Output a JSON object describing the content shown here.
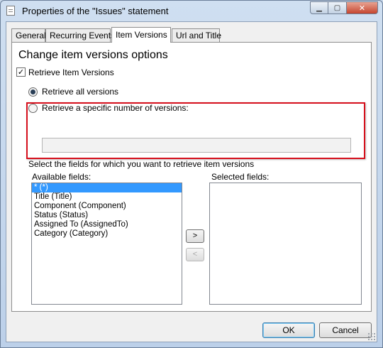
{
  "window": {
    "title": "Properties of the \"Issues\" statement"
  },
  "tabs": [
    {
      "label": "General"
    },
    {
      "label": "Recurring Events"
    },
    {
      "label": "Item Versions"
    },
    {
      "label": "Url and Title"
    }
  ],
  "panel": {
    "heading": "Change item versions options",
    "retrieve_checkbox": {
      "label": "Retrieve Item Versions",
      "checked": true
    },
    "radio_all": {
      "label": "Retrieve all versions",
      "selected": true
    },
    "radio_specific": {
      "label": "Retrieve a specific number of versions:",
      "selected": false
    },
    "number_of_versions": {
      "value": ""
    },
    "fields_prompt": "Select the fields for which you want to retrieve item versions",
    "available_label": "Available fields:",
    "selected_label": "Selected fields:",
    "available_fields": [
      "* (*)",
      "Title (Title)",
      "Component (Component)",
      "Status (Status)",
      "Assigned To (AssignedTo)",
      "Category (Category)"
    ],
    "selected_fields": [],
    "add_button": ">",
    "remove_button": "<"
  },
  "footer": {
    "ok": "OK",
    "cancel": "Cancel"
  },
  "colors": {
    "highlight_box": "#d60f1c",
    "selection": "#3399ff"
  }
}
